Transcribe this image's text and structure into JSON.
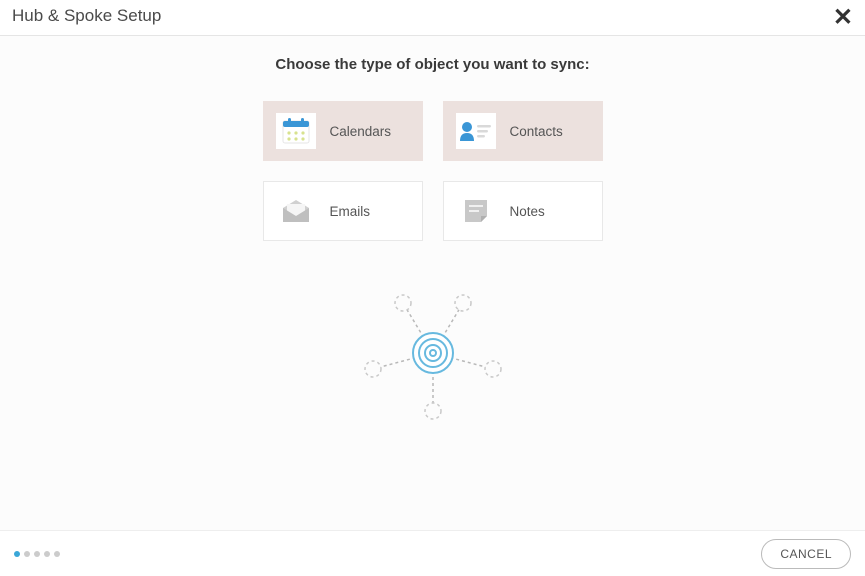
{
  "header": {
    "title": "Hub & Spoke Setup"
  },
  "prompt": "Choose the type of object you want to sync:",
  "tiles": {
    "calendars": {
      "label": "Calendars",
      "selected": true
    },
    "contacts": {
      "label": "Contacts",
      "selected": true
    },
    "emails": {
      "label": "Emails",
      "selected": false
    },
    "notes": {
      "label": "Notes",
      "selected": false
    }
  },
  "footer": {
    "cancel_label": "CANCEL",
    "total_steps": 5,
    "current_step": 1
  }
}
